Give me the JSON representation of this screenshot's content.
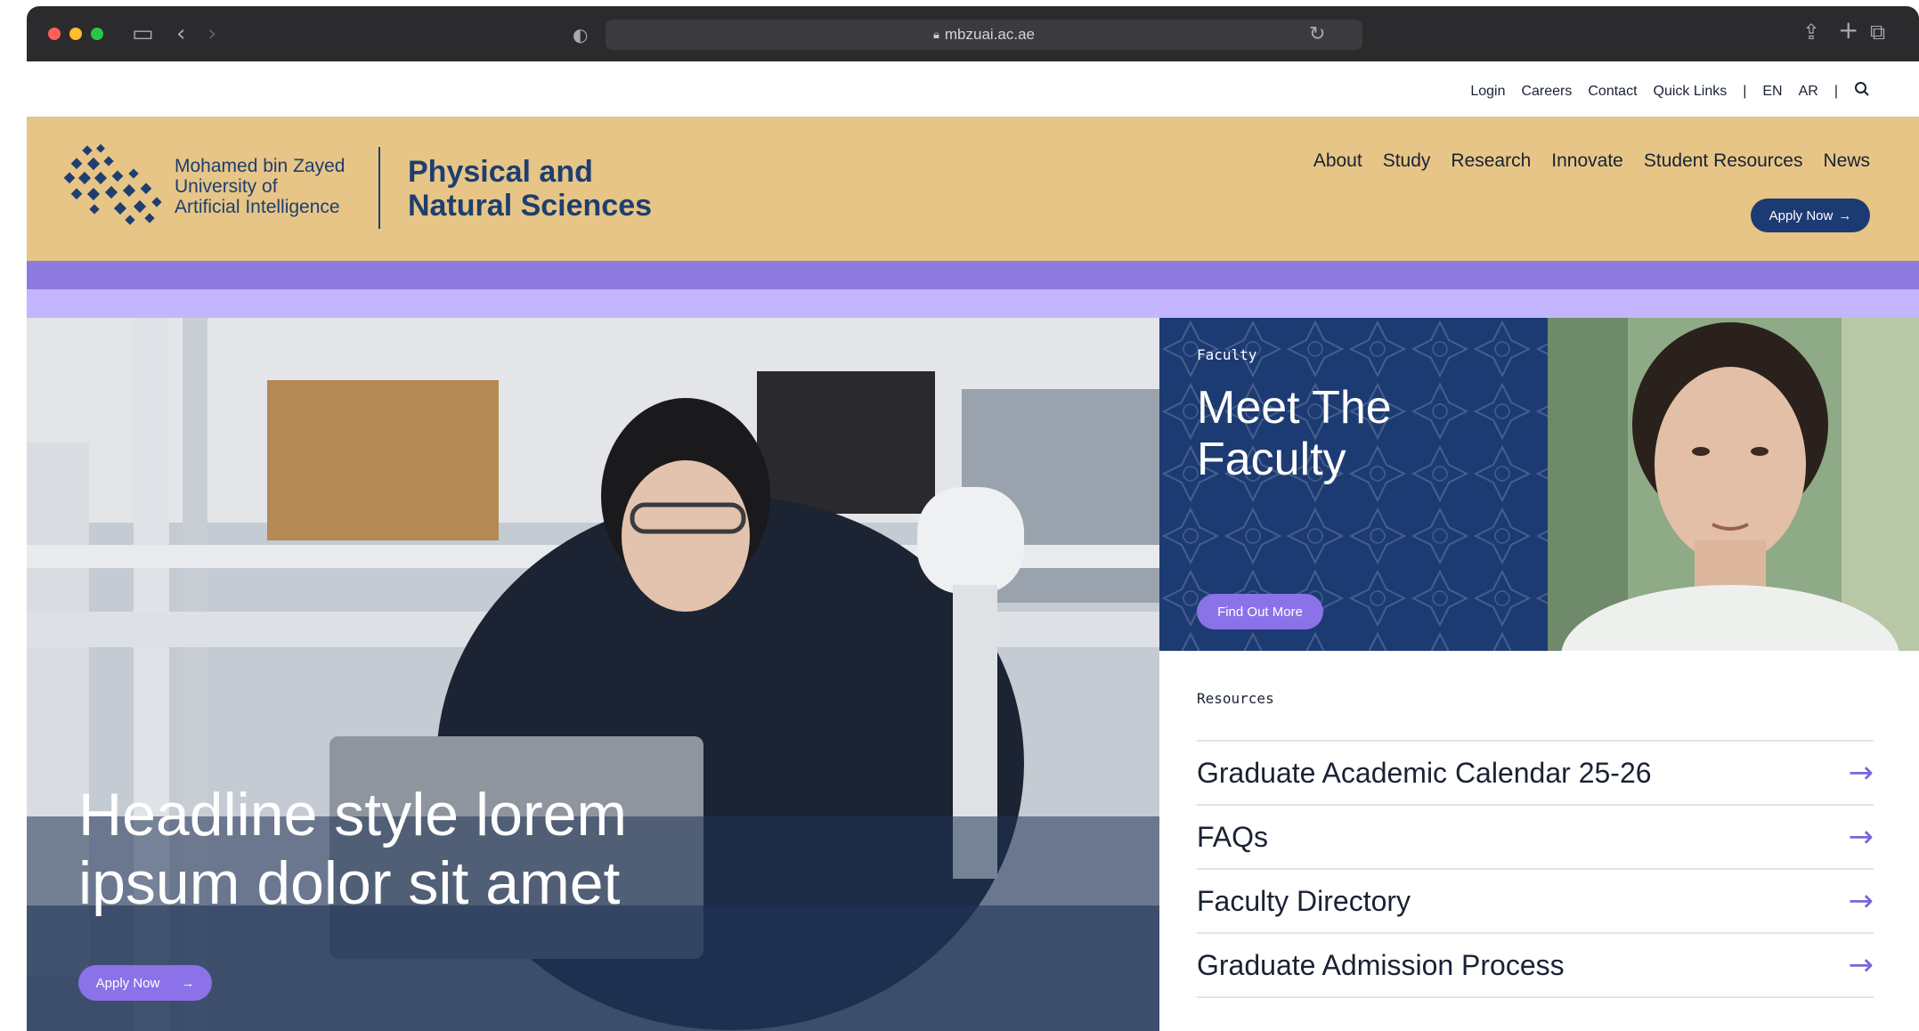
{
  "browser": {
    "url": "mbzuai.ac.ae",
    "traffic_lights": [
      "#ff5f57",
      "#febc2e",
      "#28c840"
    ]
  },
  "utility_nav": {
    "items": [
      "Login",
      "Careers",
      "Contact",
      "Quick Links"
    ],
    "languages": [
      "EN",
      "AR"
    ],
    "separator": "|"
  },
  "header": {
    "university_lines": [
      "Mohamed bin Zayed",
      "University of",
      "Artificial Intelligence"
    ],
    "department_lines": [
      "Physical and",
      "Natural Sciences"
    ],
    "nav": [
      "About",
      "Study",
      "Research",
      "Innovate",
      "Student Resources",
      "News"
    ],
    "apply_label": "Apply Now"
  },
  "hero": {
    "headline_lines": [
      "Headline style lorem",
      "ipsum dolor sit amet"
    ],
    "cta_label": "Apply Now"
  },
  "faculty": {
    "eyebrow": "Faculty",
    "title_lines": [
      "Meet The",
      "Faculty"
    ],
    "cta_label": "Find Out More"
  },
  "resources": {
    "eyebrow": "Resources",
    "items": [
      "Graduate Academic Calendar 25-26",
      "FAQs",
      "Faculty Directory",
      "Graduate Admission Process"
    ]
  },
  "colors": {
    "header_bg": "#e6c587",
    "navy": "#1d3b73",
    "purple": "#8b72e8",
    "stripe_dark": "#8e7be0",
    "stripe_light": "#c3b6ff"
  }
}
